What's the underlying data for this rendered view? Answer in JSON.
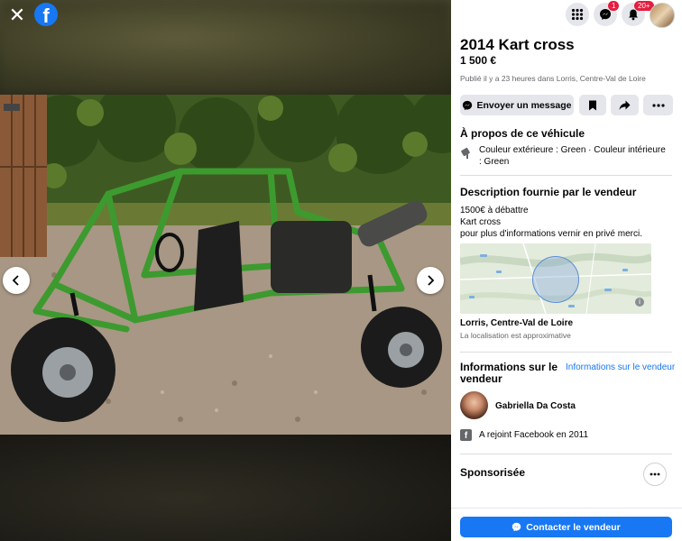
{
  "listing": {
    "title": "2014 Kart cross",
    "price": "1 500 €",
    "posted": "Publié il y a 23 heures dans Lorris, Centre-Val de Loire"
  },
  "actions": {
    "message_label": "Envoyer un message"
  },
  "topbar": {
    "messenger_badge": "1",
    "notifications_badge": "20+"
  },
  "about": {
    "heading": "À propos de ce véhicule",
    "colors": "Couleur extérieure : Green · Couleur intérieure : Green"
  },
  "description": {
    "heading": "Description fournie par le vendeur",
    "lines": [
      "1500€ à débattre",
      "Kart cross",
      "pour plus d'informations vernir en privé merci."
    ]
  },
  "location": {
    "name": "Lorris, Centre-Val de Loire",
    "note": "La localisation est approximative"
  },
  "seller": {
    "heading": "Informations sur le vendeur",
    "link": "Informations sur le vendeur",
    "name": "Gabriella Da Costa",
    "joined": "A rejoint Facebook en 2011"
  },
  "sponsored": {
    "heading": "Sponsorisée"
  },
  "contact": {
    "label": "Contacter le vendeur"
  },
  "colors": {
    "accent": "#1877f2",
    "kart_frame": "#3d9a2f",
    "badge": "#e41e3f"
  }
}
